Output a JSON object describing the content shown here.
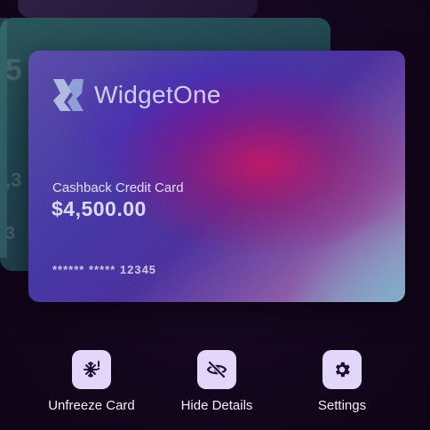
{
  "wallet": {
    "card": {
      "brand_name": "WidgetOne",
      "card_type": "Cashback Credit Card",
      "balance": "$4,500.00",
      "masked_number": "****** ***** 12345"
    },
    "back_card": {
      "ghost_glyphs": [
        "5",
        ",3",
        "3"
      ]
    }
  },
  "actions": [
    {
      "label": "Unfreeze Card",
      "icon": "snowflake-icon"
    },
    {
      "label": "Hide Details",
      "icon": "eye-off-icon"
    },
    {
      "label": "Settings",
      "icon": "gear-icon"
    }
  ],
  "colors": {
    "background": "#12061c",
    "action_tile": "#e2d7fb",
    "action_icon": "#1e0f36",
    "label": "#f2edf7"
  }
}
